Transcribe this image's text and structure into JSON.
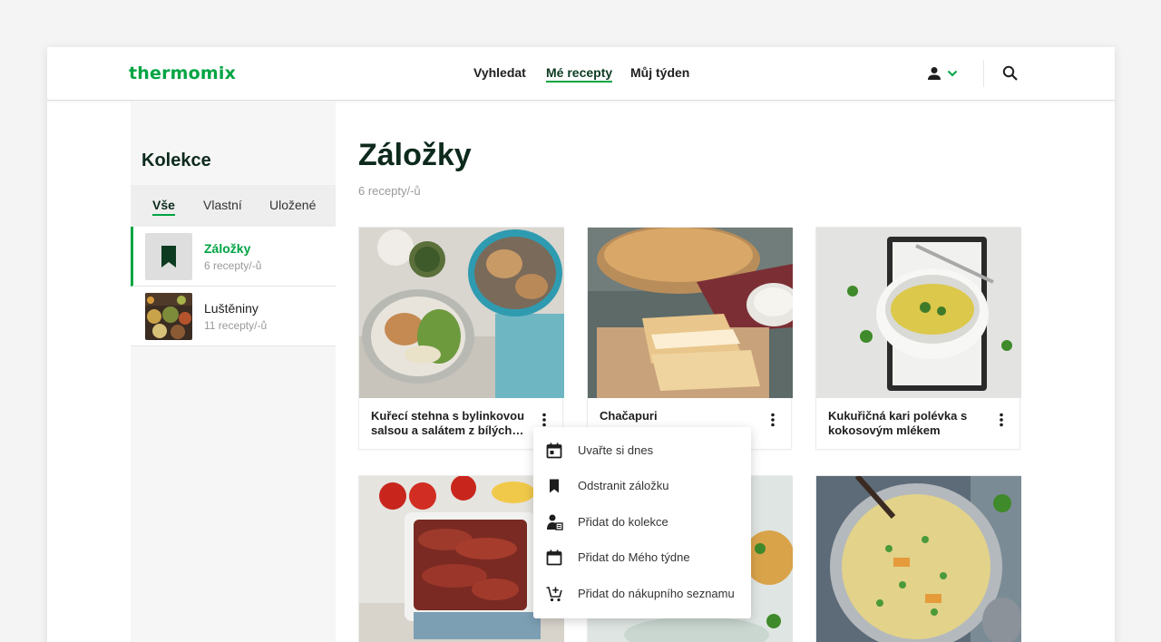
{
  "brand": {
    "logo": "thermomix",
    "accent": "#00a443",
    "dark_text": "#0d2a1c"
  },
  "nav": {
    "items": [
      "Vyhledat",
      "Mé recepty",
      "Můj týden"
    ],
    "active": "Mé recepty"
  },
  "header_icons": {
    "user": "user-icon",
    "chevron": "chevron-down-icon",
    "search": "search-icon"
  },
  "sidebar": {
    "title": "Kolekce",
    "tabs": [
      "Vše",
      "Vlastní",
      "Uložené"
    ],
    "active_tab": "Vše",
    "collections": [
      {
        "name": "Záložky",
        "count": "6 recepty/-ů",
        "icon": "bookmark-icon",
        "active": true
      },
      {
        "name": "Luštěniny",
        "count": "11 recepty/-ů",
        "icon": "legumes-thumbnail",
        "active": false
      }
    ]
  },
  "main": {
    "title": "Záložky",
    "subtitle": "6 recepty/-ů",
    "recipes": [
      {
        "title": "Kuřecí stehna s bylinkovou salsou a salátem z bílých…"
      },
      {
        "title": "Chačapuri"
      },
      {
        "title": "Kukuřičná kari polévka s kokosovým mlékem"
      },
      {
        "title": ""
      },
      {
        "title": ""
      },
      {
        "title": ""
      }
    ]
  },
  "context_menu": {
    "items": [
      {
        "label": "Uvařte si dnes",
        "icon": "calendar-today-icon"
      },
      {
        "label": "Odstranit záložku",
        "icon": "bookmark-icon"
      },
      {
        "label": "Přidat do kolekce",
        "icon": "add-to-collection-icon"
      },
      {
        "label": "Přidat do Mého týdne",
        "icon": "calendar-icon"
      },
      {
        "label": "Přidat do nákupního seznamu",
        "icon": "add-cart-icon"
      }
    ]
  }
}
